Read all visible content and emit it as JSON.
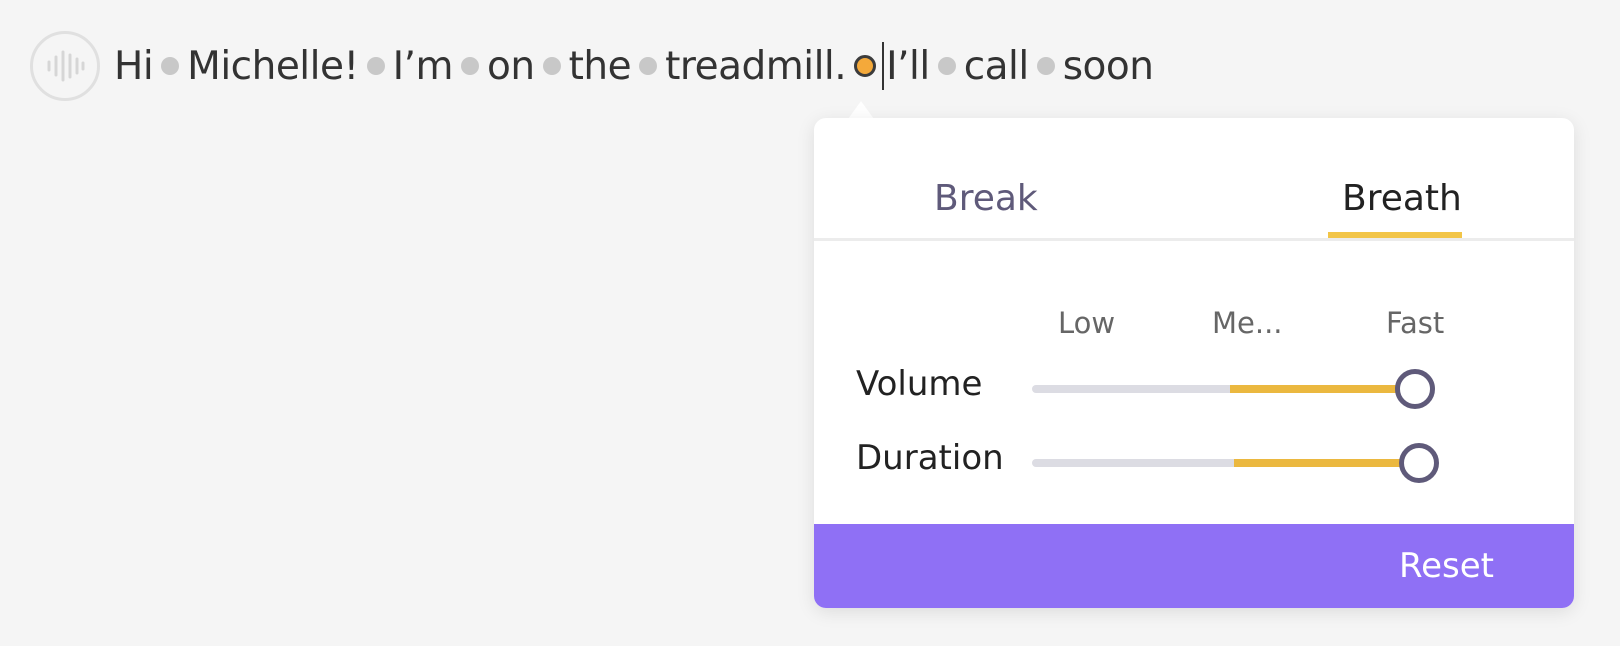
{
  "sentence": {
    "words": [
      "Hi",
      "Michelle!",
      "I’m",
      "on",
      "the",
      "treadmill.",
      "I’ll",
      "call",
      "soon"
    ],
    "active_break_after_word_index": 5
  },
  "icons": {
    "voice": "waveform-icon",
    "word_separator": "pause-dot-icon"
  },
  "popover": {
    "tabs": [
      {
        "label": "Break",
        "active": false
      },
      {
        "label": "Breath",
        "active": true
      }
    ],
    "columns": [
      "Low",
      "Me...",
      "Fast"
    ],
    "sliders": [
      {
        "label": "Volume",
        "value_fraction": 1.0
      },
      {
        "label": "Duration",
        "value_fraction": 1.0
      }
    ],
    "reset_label": "Reset"
  },
  "colors": {
    "accent": "#f2c548",
    "slider_fill": "#ebb83f",
    "footer": "#8f70f5",
    "active_dot": "#f4a93a",
    "thumb_border": "#5f5a7a"
  }
}
